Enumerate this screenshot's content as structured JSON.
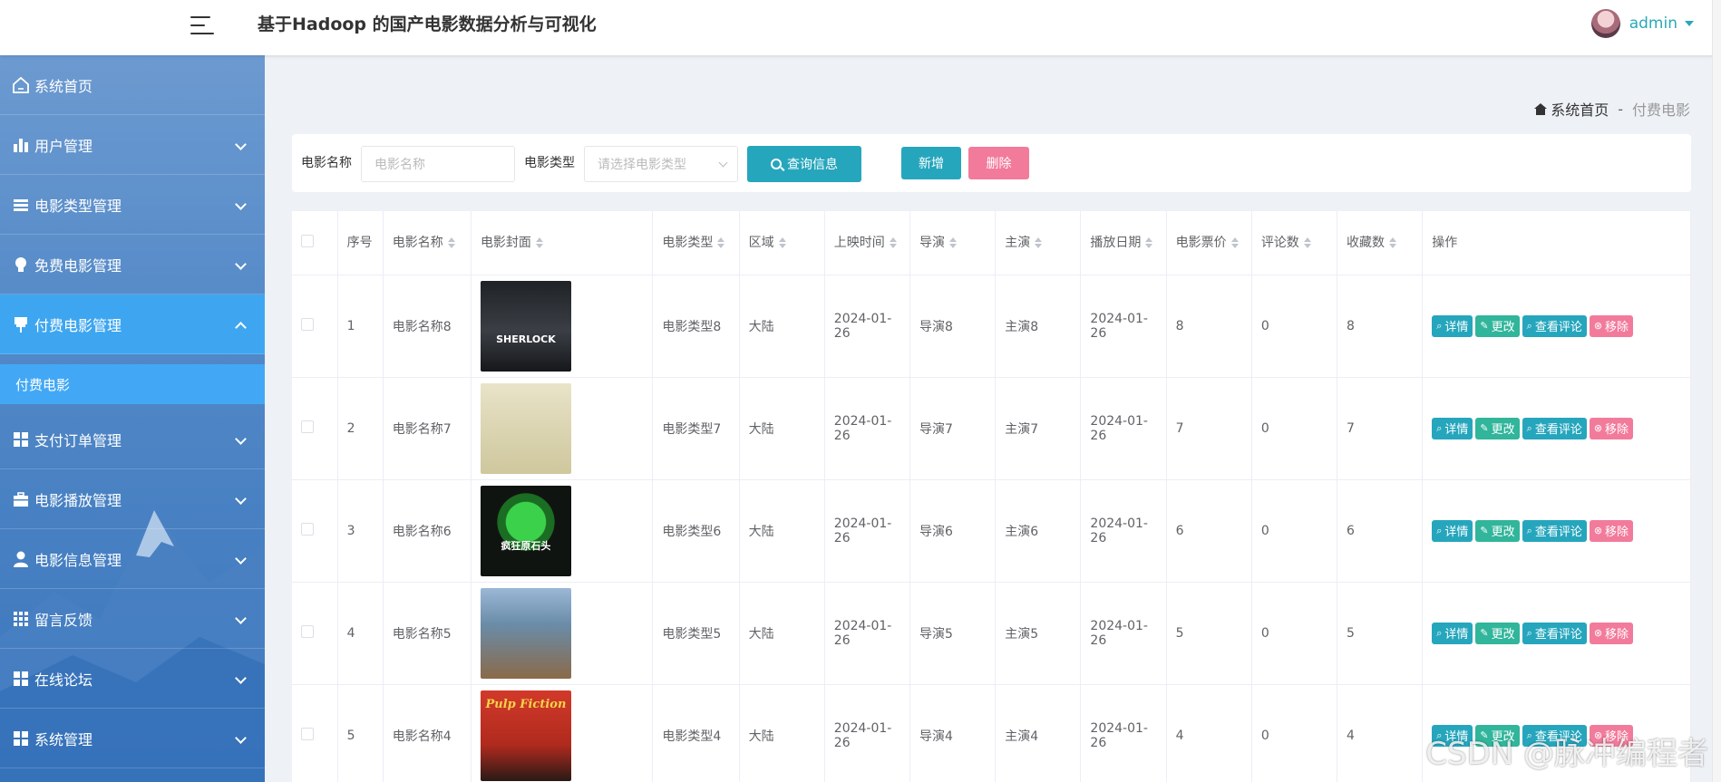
{
  "header": {
    "title": "基于Hadoop 的国产电影数据分析与可视化",
    "user": "admin"
  },
  "sidebar": {
    "items": [
      {
        "label": "系统首页",
        "icon": "home-icon"
      },
      {
        "label": "用户管理",
        "icon": "bar-chart-icon"
      },
      {
        "label": "电影类型管理",
        "icon": "list-icon"
      },
      {
        "label": "免费电影管理",
        "icon": "bulb-icon"
      },
      {
        "label": "付费电影管理",
        "icon": "pin-icon"
      },
      {
        "label": "支付订单管理",
        "icon": "grid-icon"
      },
      {
        "label": "电影播放管理",
        "icon": "briefcase-icon"
      },
      {
        "label": "电影信息管理",
        "icon": "user-icon"
      },
      {
        "label": "留言反馈",
        "icon": "apps-icon"
      },
      {
        "label": "在线论坛",
        "icon": "grid-icon"
      },
      {
        "label": "系统管理",
        "icon": "grid-icon"
      }
    ],
    "sub_item": "付费电影"
  },
  "breadcrumb": {
    "home": "系统首页",
    "separator": "-",
    "current": "付费电影"
  },
  "search": {
    "name_label": "电影名称",
    "name_placeholder": "电影名称",
    "type_label": "电影类型",
    "type_placeholder": "请选择电影类型",
    "search_button": "查询信息"
  },
  "actions": {
    "add": "新增",
    "delete": "删除"
  },
  "table": {
    "headers": [
      "序号",
      "电影名称",
      "电影封面",
      "电影类型",
      "区域",
      "上映时间",
      "导演",
      "主演",
      "播放日期",
      "电影票价",
      "评论数",
      "收藏数",
      "操作"
    ],
    "op_labels": {
      "detail": "详情",
      "edit": "更改",
      "review": "查看评论",
      "remove": "移除"
    },
    "rows": [
      {
        "no": "1",
        "name": "电影名称8",
        "type": "电影类型8",
        "region": "大陆",
        "release": "2024-01-26",
        "director": "导演8",
        "actor": "主演8",
        "play_date": "2024-01-26",
        "price": "8",
        "comments": "0",
        "favorites": "8",
        "poster_title": "SHERLOCK"
      },
      {
        "no": "2",
        "name": "电影名称7",
        "type": "电影类型7",
        "region": "大陆",
        "release": "2024-01-26",
        "director": "导演7",
        "actor": "主演7",
        "play_date": "2024-01-26",
        "price": "7",
        "comments": "0",
        "favorites": "7",
        "poster_title": ""
      },
      {
        "no": "3",
        "name": "电影名称6",
        "type": "电影类型6",
        "region": "大陆",
        "release": "2024-01-26",
        "director": "导演6",
        "actor": "主演6",
        "play_date": "2024-01-26",
        "price": "6",
        "comments": "0",
        "favorites": "6",
        "poster_title": "疯狂原石头"
      },
      {
        "no": "4",
        "name": "电影名称5",
        "type": "电影类型5",
        "region": "大陆",
        "release": "2024-01-26",
        "director": "导演5",
        "actor": "主演5",
        "play_date": "2024-01-26",
        "price": "5",
        "comments": "0",
        "favorites": "5",
        "poster_title": ""
      },
      {
        "no": "5",
        "name": "电影名称4",
        "type": "电影类型4",
        "region": "大陆",
        "release": "2024-01-26",
        "director": "导演4",
        "actor": "主演4",
        "play_date": "2024-01-26",
        "price": "4",
        "comments": "0",
        "favorites": "4",
        "poster_title": "Pulp Fiction"
      }
    ]
  },
  "watermark": "CSDN @脉冲编程者",
  "colors": {
    "accent": "#26a6bd",
    "edit": "#31b59b",
    "danger": "#f27b9b",
    "sidebar_active": "#3ea6f0"
  }
}
